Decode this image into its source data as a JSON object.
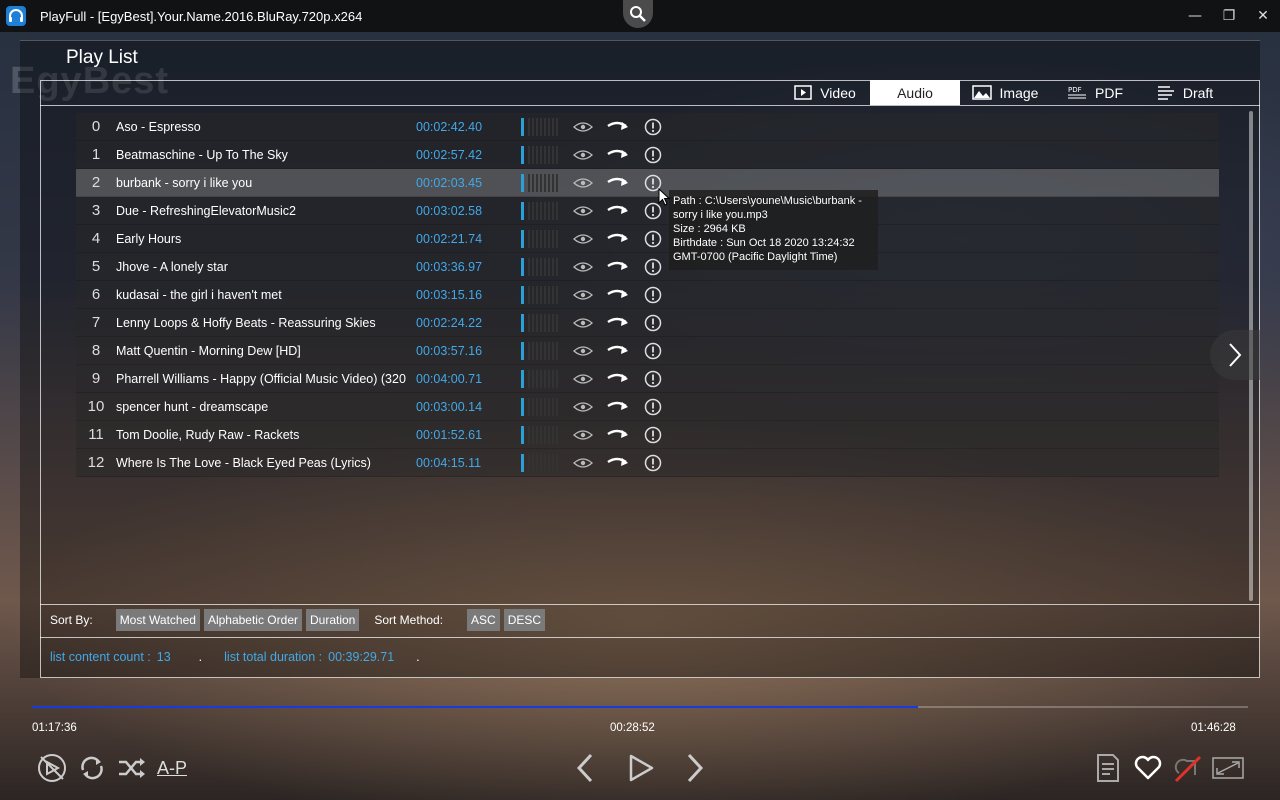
{
  "app": {
    "title": "PlayFull - [EgyBest].Your.Name.2016.BluRay.720p.x264",
    "watermark": "EgyBest",
    "window_controls": {
      "minimize": "—",
      "maximize": "❐",
      "close": "✕"
    }
  },
  "playlist": {
    "title": "Play List",
    "tabs": [
      {
        "label": "Video",
        "icon": "video-icon",
        "active": false
      },
      {
        "label": "Audio",
        "icon": "",
        "active": true
      },
      {
        "label": "Image",
        "icon": "image-icon",
        "active": false
      },
      {
        "label": "PDF",
        "icon": "pdf-icon",
        "active": false
      },
      {
        "label": "Draft",
        "icon": "draft-icon",
        "active": false
      }
    ],
    "items": [
      {
        "index": "0",
        "name": "Aso - Espresso",
        "duration": "00:02:42.40"
      },
      {
        "index": "1",
        "name": "Beatmaschine - Up To The Sky",
        "duration": "00:02:57.42"
      },
      {
        "index": "2",
        "name": "burbank - sorry i like you",
        "duration": "00:02:03.45"
      },
      {
        "index": "3",
        "name": "Due - RefreshingElevatorMusic2",
        "duration": "00:03:02.58"
      },
      {
        "index": "4",
        "name": "Early Hours",
        "duration": "00:02:21.74"
      },
      {
        "index": "5",
        "name": "Jhove - A lonely star",
        "duration": "00:03:36.97"
      },
      {
        "index": "6",
        "name": "kudasai - the girl i haven't met",
        "duration": "00:03:15.16"
      },
      {
        "index": "7",
        "name": "Lenny Loops & Hoffy Beats - Reassuring Skies",
        "duration": "00:02:24.22"
      },
      {
        "index": "8",
        "name": "Matt Quentin - Morning Dew [HD]",
        "duration": "00:03:57.16"
      },
      {
        "index": "9",
        "name": "Pharrell Williams - Happy (Official Music Video) (320",
        "duration": "00:04:00.71"
      },
      {
        "index": "10",
        "name": "spencer hunt - dreamscape",
        "duration": "00:03:00.14"
      },
      {
        "index": "11",
        "name": "Tom Doolie, Rudy Raw - Rackets",
        "duration": "00:01:52.61"
      },
      {
        "index": "12",
        "name": "Where Is The Love - Black Eyed Peas (Lyrics)",
        "duration": "00:04:15.11"
      }
    ],
    "hovered_index": 2,
    "tooltip": "Path : C:\\Users\\youne\\Music\\burbank - sorry i like you.mp3\nSize : 2964 KB\nBirthdate : Sun Oct 18 2020 13:24:32 GMT-0700 (Pacific Daylight Time)",
    "sort": {
      "label": "Sort By:",
      "options": [
        "Most Watched",
        "Alphabetic Order",
        "Duration"
      ],
      "method_label": "Sort Method:",
      "methods": [
        "ASC",
        "DESC"
      ]
    },
    "stats": {
      "count_label": "list content count :",
      "count_value": "13",
      "separator": ".",
      "duration_label": "list total duration :",
      "duration_value": "00:39:29.71"
    }
  },
  "player": {
    "elapsed": "01:17:36",
    "hover_time": "00:28:52",
    "total": "01:46:28",
    "progress_fraction": 0.729,
    "ap_label": "A-P",
    "colors": {
      "accent": "#42a8e8",
      "progress": "#1a39e0"
    }
  }
}
